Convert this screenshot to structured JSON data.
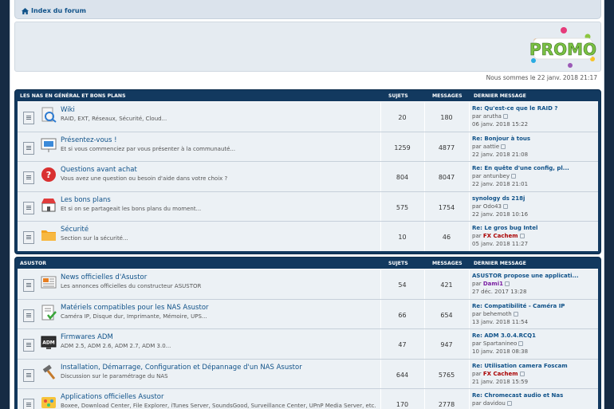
{
  "nav": {
    "breadcrumb": "Index du forum"
  },
  "banner": {
    "promo": "PROMO"
  },
  "date_line": "Nous sommes le 22 janv. 2018 21:17",
  "sections": [
    {
      "title": "LES NAS EN GÉNÉRAL ET BONS PLANS",
      "col_topics": "SUJETS",
      "col_posts": "MESSAGES",
      "col_last": "DERNIER MESSAGE",
      "rows": [
        {
          "icon": "wiki-icon",
          "title": "Wiki",
          "desc": "RAID, EXT, Réseaux, Sécurité, Cloud...",
          "topics": "20",
          "posts": "180",
          "last_title": "Re: Qu'est-ce que le RAID ?",
          "by_prefix": "par",
          "author": "arutha",
          "author_color": "#555555",
          "when": "06 janv. 2018 15:22"
        },
        {
          "icon": "presentation-icon",
          "title": "Présentez-vous !",
          "desc": "Et si vous commenciez par vous présenter à la communauté...",
          "topics": "1259",
          "posts": "4877",
          "last_title": "Re: Bonjour à tous",
          "by_prefix": "par",
          "author": "aattie",
          "author_color": "#555555",
          "when": "22 janv. 2018 21:08"
        },
        {
          "icon": "question-icon",
          "title": "Questions avant achat",
          "desc": "Vous avez une question ou besoin d'aide dans votre choix ?",
          "topics": "804",
          "posts": "8047",
          "last_title": "Re: En quête d'une config, pl...",
          "by_prefix": "par",
          "author": "antunbey",
          "author_color": "#555555",
          "when": "22 janv. 2018 21:01"
        },
        {
          "icon": "shop-icon",
          "title": "Les bons plans",
          "desc": "Et si on se partageait les bons plans du moment...",
          "topics": "575",
          "posts": "1754",
          "last_title": "synology ds 218j",
          "by_prefix": "par",
          "author": "Odo43",
          "author_color": "#555555",
          "when": "22 janv. 2018 10:16"
        },
        {
          "icon": "folder-icon",
          "title": "Sécurité",
          "desc": "Section sur la sécurité...",
          "topics": "10",
          "posts": "46",
          "last_title": "Re: Le gros bug Intel",
          "by_prefix": "par",
          "author": "FX Cachem",
          "author_color": "#aa0000",
          "when": "05 janv. 2018 11:27"
        }
      ]
    },
    {
      "title": "ASUSTOR",
      "col_topics": "SUJETS",
      "col_posts": "MESSAGES",
      "col_last": "DERNIER MESSAGE",
      "rows": [
        {
          "icon": "news-icon",
          "title": "News officielles d'Asustor",
          "desc": "Les annonces officielles du constructeur ASUSTOR",
          "topics": "54",
          "posts": "421",
          "last_title": "ASUSTOR propose une applicati...",
          "by_prefix": "par",
          "author": "Dami1",
          "author_color": "#7a1fa2",
          "when": "27 déc. 2017 13:28"
        },
        {
          "icon": "checklist-icon",
          "title": "Matériels compatibles pour les NAS Asustor",
          "desc": "Caméra IP, Disque dur, Imprimante, Mémoire, UPS...",
          "topics": "66",
          "posts": "654",
          "last_title": "Re: Compatibilité - Caméra IP",
          "by_prefix": "par",
          "author": "behemoth",
          "author_color": "#555555",
          "when": "13 janv. 2018 11:54"
        },
        {
          "icon": "adm-icon",
          "title": "Firmwares ADM",
          "desc": "ADM 2.5, ADM 2.6, ADM 2.7, ADM 3.0...",
          "topics": "47",
          "posts": "947",
          "last_title": "Re: ADM 3.0.4.RCQ1",
          "by_prefix": "par",
          "author": "Spartanineo",
          "author_color": "#555555",
          "when": "10 janv. 2018 08:38"
        },
        {
          "icon": "hammer-icon",
          "title": "Installation, Démarrage, Configuration et Dépannage d'un NAS Asustor",
          "desc": "Discussion sur le paramétrage du NAS",
          "topics": "644",
          "posts": "5765",
          "last_title": "Re: Utilisation camera Foscam",
          "by_prefix": "par",
          "author": "FX Cachem",
          "author_color": "#aa0000",
          "when": "21 janv. 2018 15:59"
        },
        {
          "icon": "apps-icon",
          "title": "Applications officielles Asustor",
          "desc": "Boxee, Download Center, File Explorer, iTunes Server, SoundsGood, Surveillance Center, UPnP Media Server, etc.",
          "topics": "170",
          "posts": "2778",
          "last_title": "Re: Chromecast audio et Nas",
          "by_prefix": "par",
          "author": "davidou",
          "author_color": "#555555",
          "when": ""
        }
      ]
    }
  ]
}
